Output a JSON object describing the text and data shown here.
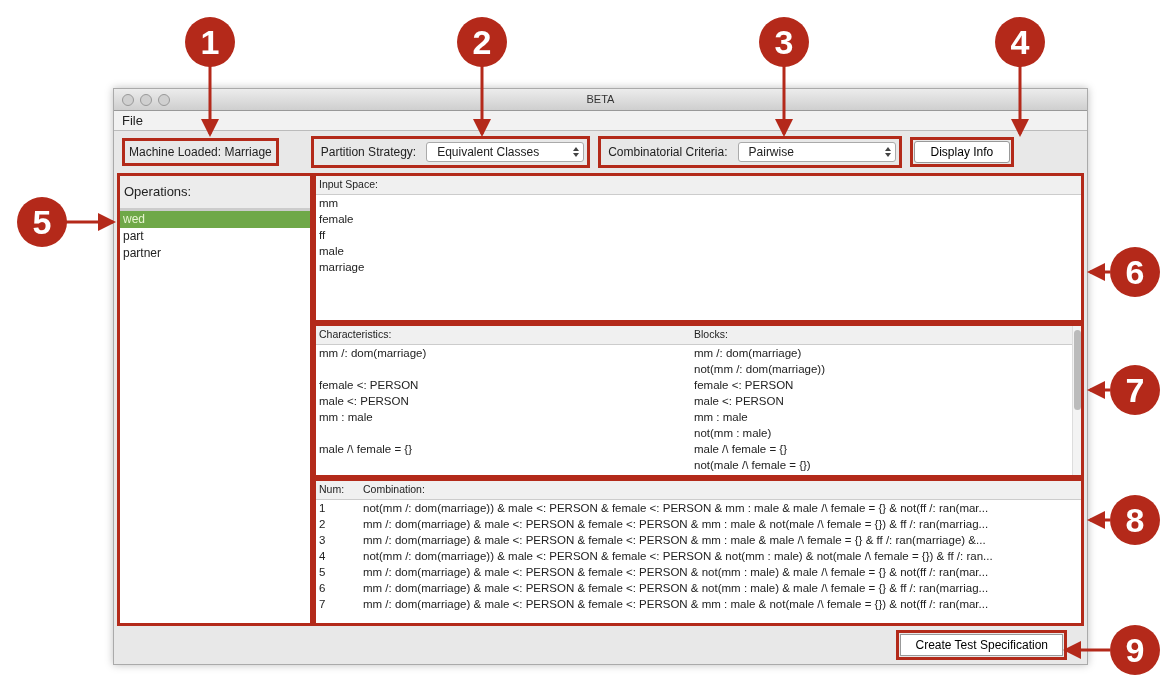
{
  "window": {
    "title": "BETA"
  },
  "menu": [
    "File"
  ],
  "toolbar": {
    "machine_loaded": "Machine Loaded: Marriage",
    "partition_label": "Partition Strategy:",
    "partition_value": "Equivalent Classes",
    "criteria_label": "Combinatorial Criteria:",
    "criteria_value": "Pairwise",
    "display_button": "Display Info"
  },
  "operations": {
    "header": "Operations:",
    "items": [
      {
        "label": "wed",
        "selected": true
      },
      {
        "label": "part",
        "selected": false
      },
      {
        "label": "partner",
        "selected": false
      }
    ]
  },
  "input_space": {
    "header": "Input Space:",
    "items": [
      "mm",
      "female",
      "ff",
      "male",
      "marriage"
    ]
  },
  "characteristics_table": {
    "columns": [
      "Characteristics:",
      "Blocks:"
    ],
    "rows": [
      {
        "characteristic": "mm /: dom(marriage)",
        "block": "mm /: dom(marriage)"
      },
      {
        "block": "not(mm /: dom(marriage))"
      },
      {
        "characteristic": "female <: PERSON",
        "block": "female <: PERSON"
      },
      {
        "characteristic": "male <: PERSON",
        "block": "male <: PERSON"
      },
      {
        "characteristic": "mm : male",
        "block": "mm : male"
      },
      {
        "block": "not(mm : male)"
      },
      {
        "characteristic": "male /\\ female = {}",
        "block": "male /\\ female = {}"
      },
      {
        "block": "not(male /\\ female = {})"
      }
    ]
  },
  "combinations_table": {
    "columns": [
      "Num:",
      "Combination:"
    ],
    "rows": [
      {
        "num": "1",
        "combination": "not(mm /: dom(marriage)) & male <: PERSON & female <: PERSON & mm : male & male /\\ female = {} & not(ff /: ran(mar..."
      },
      {
        "num": "2",
        "combination": "mm /: dom(marriage) & male <: PERSON & female <: PERSON & mm : male & not(male /\\ female = {}) & ff /: ran(marriag..."
      },
      {
        "num": "3",
        "combination": "mm /: dom(marriage) & male <: PERSON & female <: PERSON & mm : male & male /\\ female = {} & ff /: ran(marriage) &..."
      },
      {
        "num": "4",
        "combination": "not(mm /: dom(marriage)) & male <: PERSON & female <: PERSON & not(mm : male) & not(male /\\ female = {}) & ff /: ran..."
      },
      {
        "num": "5",
        "combination": "mm /: dom(marriage) & male <: PERSON & female <: PERSON & not(mm : male) & male /\\ female = {} & not(ff /: ran(mar..."
      },
      {
        "num": "6",
        "combination": "mm /: dom(marriage) & male <: PERSON & female <: PERSON & not(mm : male) & male /\\ female = {} & ff /: ran(marriag..."
      },
      {
        "num": "7",
        "combination": "mm /: dom(marriage) & male <: PERSON & female <: PERSON & mm : male & not(male /\\ female = {}) & not(ff /: ran(mar..."
      }
    ]
  },
  "create_button": "Create Test Specification",
  "callouts": [
    "1",
    "2",
    "3",
    "4",
    "5",
    "6",
    "7",
    "8",
    "9"
  ]
}
